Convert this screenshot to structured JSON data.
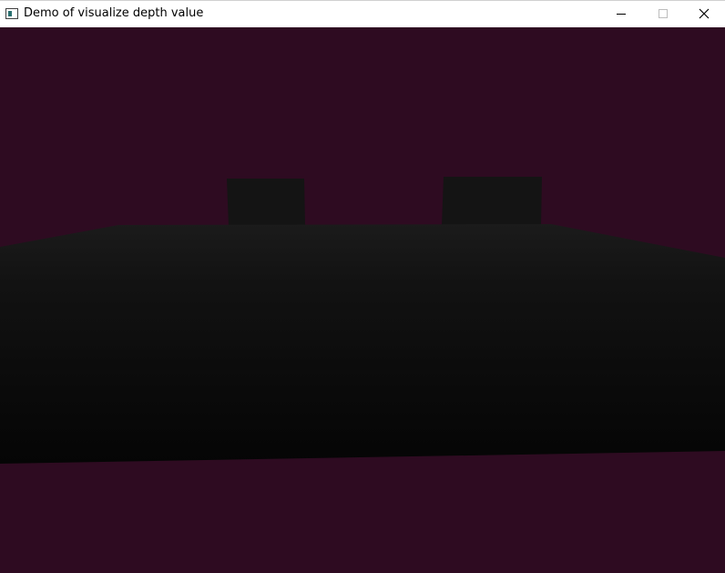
{
  "window": {
    "title": "Demo of visualize depth value",
    "icon": "app-window-icon",
    "controls": {
      "minimize_icon": "minimize-icon",
      "maximize_icon": "maximize-icon",
      "close_icon": "close-icon"
    }
  },
  "scene": {
    "background_color": "#2e0b21",
    "objects": [
      {
        "name": "slab",
        "color_top": "#1b1b1b",
        "color_bottom": "#050505"
      },
      {
        "name": "left-block",
        "color": "#141414"
      },
      {
        "name": "right-block",
        "color": "#141414"
      }
    ]
  }
}
